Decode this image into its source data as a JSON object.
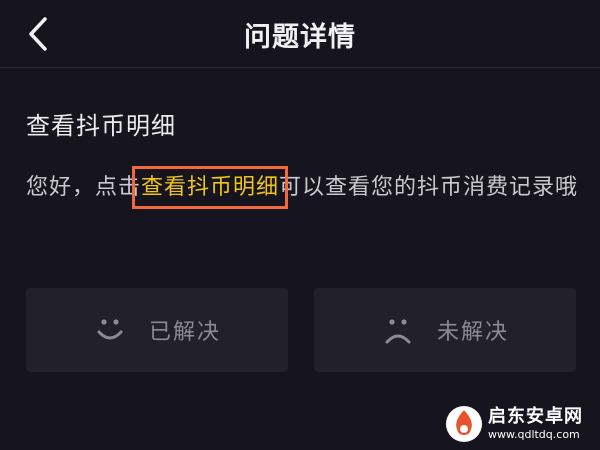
{
  "header": {
    "title": "问题详情",
    "back_icon": "chevron-left-icon"
  },
  "question": {
    "title": "查看抖币明细"
  },
  "answer": {
    "text_before": "您好，点击",
    "link_text": "查看抖币明细",
    "text_after": "可以查看您的抖币消费记录哦"
  },
  "feedback": {
    "resolved": {
      "label": "已解决",
      "icon": "smile-face-icon"
    },
    "unresolved": {
      "label": "未解决",
      "icon": "sad-face-icon"
    }
  },
  "watermark": {
    "main": "启东安卓网",
    "url": "www.qdltdq.com"
  },
  "colors": {
    "background": "#15141f",
    "link": "#f0c419",
    "highlight_box": "#f06a3a",
    "button_bg": "#21202b"
  }
}
